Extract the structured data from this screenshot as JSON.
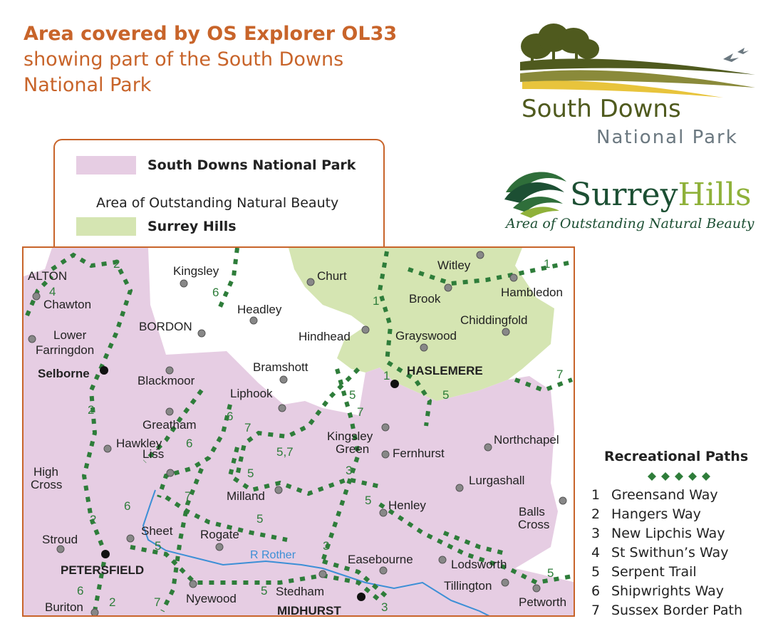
{
  "header": {
    "line1": "Area covered by OS Explorer OL33",
    "line2": "showing part of the South Downs",
    "line3": "National Park"
  },
  "logos": {
    "south_downs_line1": "South Downs",
    "south_downs_line2": "National Park",
    "surrey_hills_part1": "Surrey",
    "surrey_hills_part2": "Hills",
    "surrey_hills_tagline": "Area of Outstanding Natural Beauty"
  },
  "legend": {
    "sdnp_label": "South Downs National Park",
    "aonb_label": "Area of Outstanding Natural Beauty",
    "surrey_hills_label": "Surrey Hills"
  },
  "colors": {
    "national_park": "#e6cde3",
    "aonb": "#d5e5b2",
    "path": "#2e7d3a",
    "river": "#3c8fd6",
    "border": "#c8642a",
    "title": "#c8642a"
  },
  "map": {
    "places": [
      {
        "name": "ALTON"
      },
      {
        "name": "Chawton"
      },
      {
        "name": "Lower"
      },
      {
        "name": "Farringdon"
      },
      {
        "name": "Selborne"
      },
      {
        "name": "Kingsley"
      },
      {
        "name": "BORDON"
      },
      {
        "name": "Headley"
      },
      {
        "name": "Blackmoor"
      },
      {
        "name": "Bramshott"
      },
      {
        "name": "Liphook"
      },
      {
        "name": "Greatham"
      },
      {
        "name": "Hawkley"
      },
      {
        "name": "Liss"
      },
      {
        "name": "High"
      },
      {
        "name": "Cross"
      },
      {
        "name": "Milland"
      },
      {
        "name": "Rogate"
      },
      {
        "name": "Sheet"
      },
      {
        "name": "Stroud"
      },
      {
        "name": "PETERSFIELD"
      },
      {
        "name": "Buriton"
      },
      {
        "name": "Nyewood"
      },
      {
        "name": "Stedham"
      },
      {
        "name": "MIDHURST"
      },
      {
        "name": "Easebourne"
      },
      {
        "name": "Henley"
      },
      {
        "name": "Kingsley"
      },
      {
        "name": "Green"
      },
      {
        "name": "Fernhurst"
      },
      {
        "name": "Lurgashall"
      },
      {
        "name": "Northchapel"
      },
      {
        "name": "Balls"
      },
      {
        "name": "Cross"
      },
      {
        "name": "Lodsworth"
      },
      {
        "name": "Tillington"
      },
      {
        "name": "Petworth"
      },
      {
        "name": "Churt"
      },
      {
        "name": "Hindhead"
      },
      {
        "name": "HASLEMERE"
      },
      {
        "name": "Grayswood"
      },
      {
        "name": "Chiddingfold"
      },
      {
        "name": "Brook"
      },
      {
        "name": "Witley"
      },
      {
        "name": "Hambledon"
      }
    ],
    "river_label": "R Rother",
    "path_numbers": [
      {
        "n": "2"
      },
      {
        "n": "4"
      },
      {
        "n": "6"
      },
      {
        "n": "1"
      },
      {
        "n": "1"
      },
      {
        "n": "1"
      },
      {
        "n": "7"
      },
      {
        "n": "5"
      },
      {
        "n": "5"
      },
      {
        "n": "7"
      },
      {
        "n": "6"
      },
      {
        "n": "7"
      },
      {
        "n": "6"
      },
      {
        "n": "5,7"
      },
      {
        "n": "5"
      },
      {
        "n": "3"
      },
      {
        "n": "2"
      },
      {
        "n": "2"
      },
      {
        "n": "6"
      },
      {
        "n": "7"
      },
      {
        "n": "5"
      },
      {
        "n": "5"
      },
      {
        "n": "5"
      },
      {
        "n": "3"
      },
      {
        "n": "5"
      },
      {
        "n": "5"
      },
      {
        "n": "6"
      },
      {
        "n": "2"
      },
      {
        "n": "7"
      },
      {
        "n": "3"
      }
    ]
  },
  "recreational_paths": {
    "title": "Recreational Paths",
    "items": [
      {
        "num": "1",
        "name": "Greensand Way"
      },
      {
        "num": "2",
        "name": "Hangers Way"
      },
      {
        "num": "3",
        "name": "New Lipchis Way"
      },
      {
        "num": "4",
        "name": "St Swithun’s Way"
      },
      {
        "num": "5",
        "name": "Serpent Trail"
      },
      {
        "num": "6",
        "name": "Shipwrights Way"
      },
      {
        "num": "7",
        "name": "Sussex Border Path"
      }
    ]
  }
}
